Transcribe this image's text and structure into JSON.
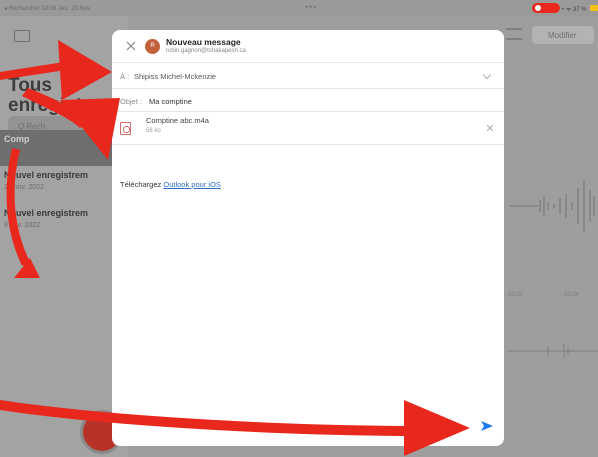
{
  "status_bar": {
    "back": "◂ Rechercher",
    "time_date": "10:08 Jeu. 23 Nov.",
    "right": "• ᯤ 37 %"
  },
  "sidebar": {
    "title_line1": "Tous",
    "title_line2": "enregistre",
    "search_placeholder": "Q Rech",
    "items": [
      {
        "name": "Comp",
        "date": ""
      },
      {
        "name": "Nouvel enregistrem",
        "date": "23 nov. 2022"
      },
      {
        "name": "Nouvel enregistrem",
        "date": "9 nov. 2022"
      }
    ]
  },
  "main": {
    "modifier_label": "Modifier",
    "time_a": "00:02",
    "time_b": "00:04"
  },
  "compose": {
    "title": "Nouveau message",
    "sender_email": "robin.gagnon@tshakapesh.ca",
    "avatar_letter": "R",
    "to_label": "À :",
    "to_value": "Shipiss Michel-Mckenzie",
    "subject_label": "Objet :",
    "subject_value": "Ma comptine",
    "attachment_name": "Comptine abc.m4a",
    "attachment_size": "56 ko",
    "body_prefix": "Téléchargez",
    "body_link": "Outlook pour iOS"
  },
  "colors": {
    "annotation_red": "#e8281c",
    "link_blue": "#2f6fc8",
    "send_blue": "#1e78f0"
  }
}
